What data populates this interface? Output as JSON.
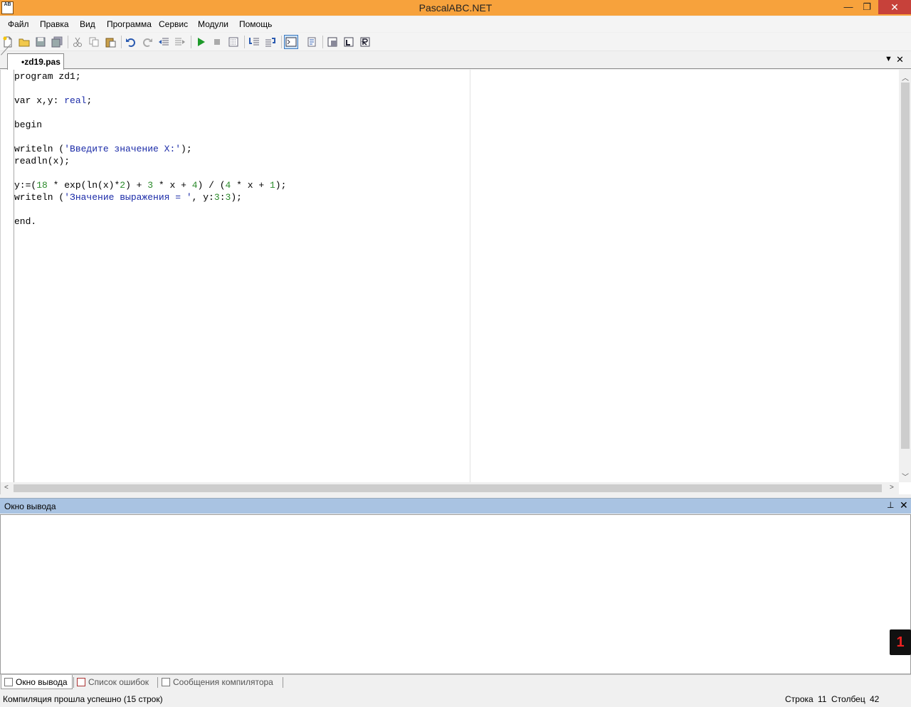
{
  "window": {
    "title": "PascalABC.NET",
    "icon_text": "AB",
    "minimize_glyph": "—",
    "maximize_glyph": "❐",
    "close_glyph": "✕",
    "accent_color": "#f7a23c"
  },
  "menu": {
    "items": [
      "Файл",
      "Правка",
      "Вид",
      "Программа",
      "Сервис",
      "Модули",
      "Помощь"
    ]
  },
  "toolbar": {
    "icons": [
      "new-file-icon",
      "open-folder-icon",
      "save-icon",
      "save-all-icon",
      "cut-icon",
      "copy-icon",
      "paste-icon",
      "undo-icon",
      "redo-icon",
      "unindent-icon",
      "indent-icon",
      "run-icon",
      "stop-icon",
      "compile-icon",
      "step-into-icon",
      "step-over-icon",
      "console-icon",
      "output-icon",
      "debug-window-icon",
      "locals-icon",
      "watch-icon"
    ]
  },
  "editor": {
    "tab_label": "•zd19.pas",
    "tab_menu_glyph": "▼",
    "tab_close_glyph": "✕",
    "code_lines": [
      [
        {
          "t": "program zd1;"
        }
      ],
      [],
      [
        {
          "t": "var x,y: "
        },
        {
          "t": "real",
          "c": "kw"
        },
        {
          "t": ";"
        }
      ],
      [],
      [
        {
          "t": "begin"
        }
      ],
      [],
      [
        {
          "t": "writeln ("
        },
        {
          "t": "'Введите значение X:'",
          "c": "kw"
        },
        {
          "t": ");"
        }
      ],
      [
        {
          "t": "readln(x);"
        }
      ],
      [],
      [
        {
          "t": "y:=("
        },
        {
          "t": "18",
          "c": "num"
        },
        {
          "t": " * exp(ln(x)*"
        },
        {
          "t": "2",
          "c": "num"
        },
        {
          "t": ") + "
        },
        {
          "t": "3",
          "c": "num"
        },
        {
          "t": " * x + "
        },
        {
          "t": "4",
          "c": "num"
        },
        {
          "t": ") / ("
        },
        {
          "t": "4",
          "c": "num"
        },
        {
          "t": " * x + "
        },
        {
          "t": "1",
          "c": "num"
        },
        {
          "t": ");"
        }
      ],
      [
        {
          "t": "writeln ("
        },
        {
          "t": "'Значение выражения = '",
          "c": "kw"
        },
        {
          "t": ", y:"
        },
        {
          "t": "3",
          "c": "num"
        },
        {
          "t": ":"
        },
        {
          "t": "3",
          "c": "num"
        },
        {
          "t": ");"
        }
      ],
      [],
      [
        {
          "t": "end."
        }
      ]
    ]
  },
  "output_panel": {
    "title": "Окно вывода",
    "pin_glyph": "⊥",
    "close_glyph": "✕",
    "corner_widget_glyph": "1"
  },
  "bottom_tabs": [
    {
      "label": "Окно вывода",
      "active": true
    },
    {
      "label": "Список ошибок",
      "active": false
    },
    {
      "label": "Сообщения компилятора",
      "active": false
    }
  ],
  "status": {
    "message": "Компиляция прошла успешно (15 строк)",
    "row_label": "Строка",
    "row_value": "11",
    "col_label": "Столбец",
    "col_value": "42"
  }
}
